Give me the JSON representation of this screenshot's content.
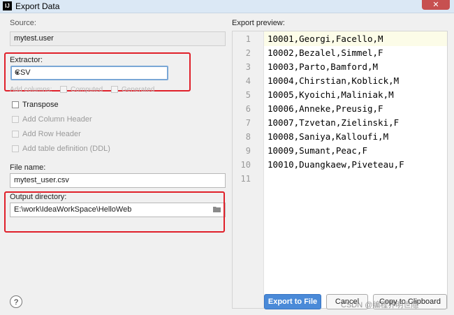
{
  "window": {
    "title": "Export Data",
    "app_icon": "intellij-icon",
    "close_label": "✕"
  },
  "source": {
    "label": "Source:",
    "value": "mytest.user"
  },
  "extractor": {
    "label": "Extractor:",
    "value": "CSV"
  },
  "add_columns": {
    "label": "Add columns:",
    "computed": "Computed",
    "generated": "Generated"
  },
  "options": [
    {
      "label": "Transpose",
      "enabled": true
    },
    {
      "label": "Add Column Header",
      "enabled": false
    },
    {
      "label": "Add Row Header",
      "enabled": false
    },
    {
      "label": "Add table definition (DDL)",
      "enabled": false
    }
  ],
  "file_name": {
    "label": "File name:",
    "value": "mytest_user.csv"
  },
  "output_dir": {
    "label": "Output directory:",
    "value": "E:\\work\\IdeaWorkSpace\\HelloWeb"
  },
  "preview": {
    "label": "Export preview:",
    "lines": [
      "10001,Georgi,Facello,M",
      "10002,Bezalel,Simmel,F",
      "10003,Parto,Bamford,M",
      "10004,Chirstian,Koblick,M",
      "10005,Kyoichi,Maliniak,M",
      "10006,Anneke,Preusig,F",
      "10007,Tzvetan,Zielinski,F",
      "10008,Saniya,Kalloufi,M",
      "10009,Sumant,Peac,F",
      "10010,Duangkaew,Piveteau,F",
      ""
    ],
    "line_numbers": [
      "1",
      "2",
      "3",
      "4",
      "5",
      "6",
      "7",
      "8",
      "9",
      "10",
      "11"
    ]
  },
  "buttons": {
    "export": "Export to File",
    "cancel": "Cancel",
    "copy": "Copy to Clipboard",
    "help": "?"
  },
  "watermark": "CSDN @编程界明世隐"
}
